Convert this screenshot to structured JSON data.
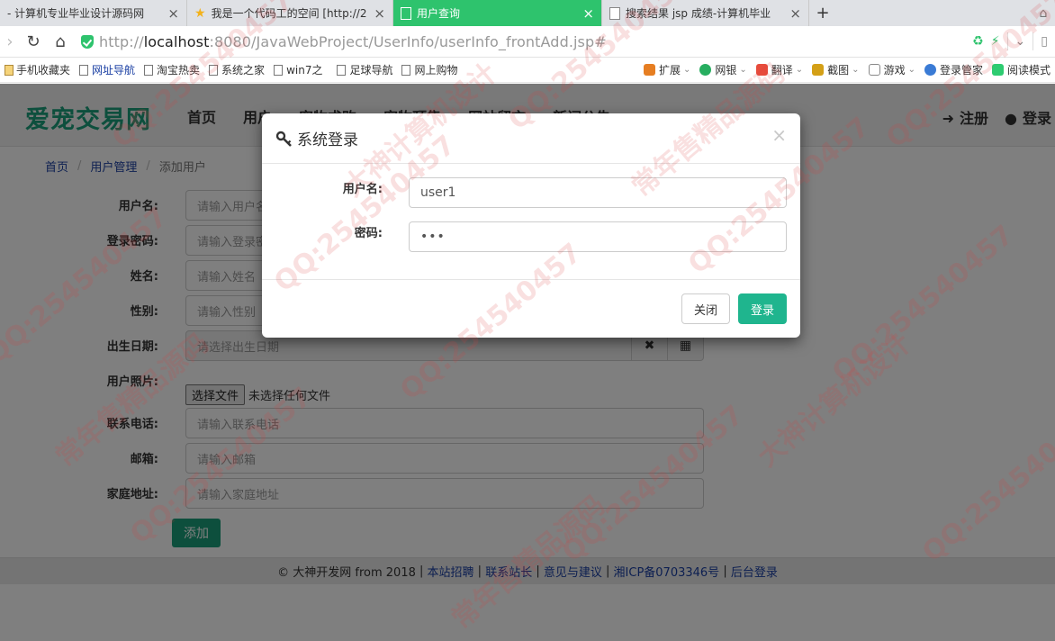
{
  "browser": {
    "tabs": [
      {
        "title": "- 计算机专业毕业设计源码网",
        "active": false,
        "icon": "doc-icon"
      },
      {
        "title": "我是一个代码工的空间 [http://2",
        "active": false,
        "icon": "star-icon"
      },
      {
        "title": "用户查询",
        "active": true,
        "icon": "doc-icon"
      },
      {
        "title": "搜索结果 jsp 成绩-计算机毕业",
        "active": false,
        "icon": "doc-icon"
      }
    ],
    "new_tab": "+",
    "url_prefix": "http://",
    "url_host": "localhost",
    "url_rest": ":8080/JavaWebProject/UserInfo/userInfo_frontAdd.jsp#",
    "accent_color": "#2ec36d",
    "bookmarks_left": [
      {
        "label": "手机收藏夹",
        "icon": "folder-icon",
        "link": false
      },
      {
        "label": "网址导航",
        "icon": "doc-icon",
        "link": true
      },
      {
        "label": "淘宝热卖",
        "icon": "doc-icon",
        "link": false
      },
      {
        "label": "系统之家",
        "icon": "doc-icon",
        "link": false
      },
      {
        "label": "win7之",
        "icon": "doc-icon",
        "link": false
      },
      {
        "label": "足球导航",
        "icon": "doc-icon",
        "link": false
      },
      {
        "label": "网上购物",
        "icon": "doc-icon",
        "link": false
      }
    ],
    "bookmarks_right": [
      {
        "label": "扩展",
        "color": "#e67e22"
      },
      {
        "label": "网银",
        "color": "#27ae60"
      },
      {
        "label": "翻译",
        "color": "#e74c3c"
      },
      {
        "label": "截图",
        "color": "#d4a017"
      },
      {
        "label": "游戏",
        "color": "#888888"
      },
      {
        "label": "登录管家",
        "color": "#3a7bd5"
      },
      {
        "label": "阅读模式",
        "color": "#2ecc71"
      }
    ]
  },
  "site": {
    "logo": "爱宠交易网",
    "logo_color": "#1a9e7a",
    "nav": [
      "首页",
      "用户",
      "宠物求购",
      "宠物预售",
      "网站留言",
      "新闻公告"
    ],
    "register": "注册",
    "login": "登录",
    "breadcrumb": {
      "home": "首页",
      "section": "用户管理",
      "current": "添加用户"
    },
    "form": {
      "username": {
        "label": "用户名:",
        "placeholder": "请输入用户名"
      },
      "password": {
        "label": "登录密码:",
        "placeholder": "请输入登录密码"
      },
      "name": {
        "label": "姓名:",
        "placeholder": "请输入姓名"
      },
      "gender": {
        "label": "性别:",
        "placeholder": "请输入性别"
      },
      "birthday": {
        "label": "出生日期:",
        "placeholder": "请选择出生日期",
        "clear_icon": "✖",
        "calendar_icon": "▦"
      },
      "photo": {
        "label": "用户照片:",
        "button": "选择文件",
        "status": "未选择任何文件"
      },
      "phone": {
        "label": "联系电话:",
        "placeholder": "请输入联系电话"
      },
      "email": {
        "label": "邮箱:",
        "placeholder": "请输入邮箱"
      },
      "address": {
        "label": "家庭地址:",
        "placeholder": "请输入家庭地址"
      },
      "submit": "添加"
    },
    "footer": {
      "copyright": "© 大神开发网 from 2018",
      "links": [
        "本站招聘",
        "联系站长",
        "意见与建议",
        "湘ICP备0703346号",
        "后台登录"
      ]
    }
  },
  "modal": {
    "title": "系统登录",
    "close_symbol": "×",
    "username_label": "用户名:",
    "username_value": "user1",
    "password_label": "密码:",
    "password_value": "•••",
    "close_button": "关闭",
    "login_button": "登录",
    "login_color": "#1fb58e"
  },
  "watermark": [
    "QQ:254540457",
    "大神计算机设计",
    "常年售精品源码"
  ]
}
